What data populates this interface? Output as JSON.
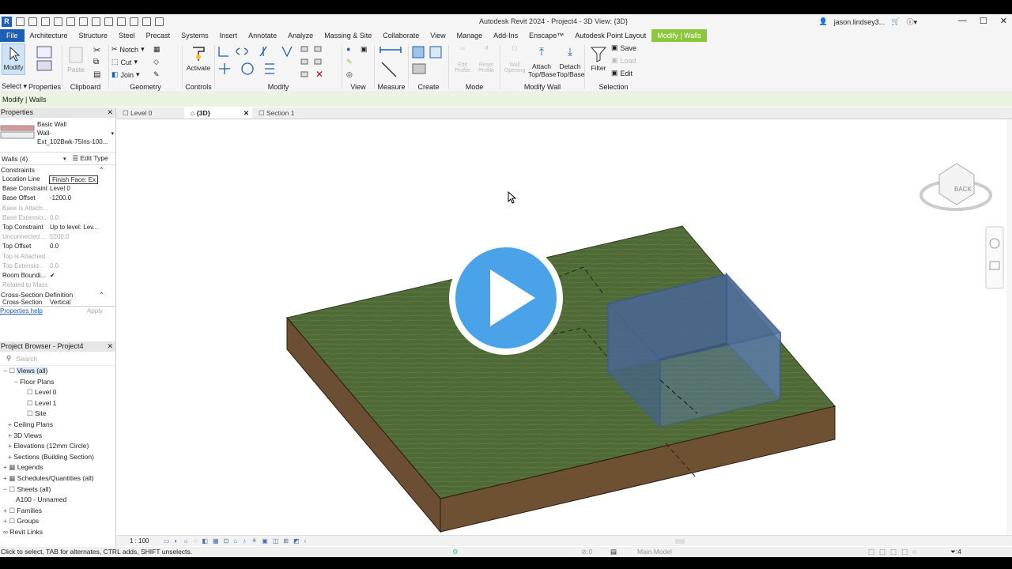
{
  "window": {
    "title": "Autodesk Revit 2024 - Project4 - 3D View: {3D}",
    "user": "jason.lindsey3..."
  },
  "menu_tabs": [
    "File",
    "Architecture",
    "Structure",
    "Steel",
    "Precast",
    "Systems",
    "Insert",
    "Annotate",
    "Analyze",
    "Massing & Site",
    "Collaborate",
    "View",
    "Manage",
    "Add-Ins",
    "Enscape™",
    "Autodesk Point Layout",
    "Modify | Walls"
  ],
  "ribbon": {
    "modify_label": "Modify",
    "select_label": "Select ▾",
    "properties_label": "Properties",
    "paste_label": "Paste",
    "clipboard_label": "Clipboard",
    "notch_label": "Notch",
    "cut_label": "Cut",
    "join_label": "Join",
    "geometry_label": "Geometry",
    "activate_label": "Activate",
    "controls_label": "Controls",
    "modify_panel_label": "Modify",
    "view_label": "View",
    "measure_label": "Measure",
    "create_label": "Create",
    "edit_profile": "Edit Profile",
    "reset_profile": "Reset Profile",
    "wall_opening": "Wall Opening",
    "mode_label": "Mode",
    "attach_top": "Attach Top/Base",
    "detach_top": "Detach Top/Base",
    "modify_wall_label": "Modify Wall",
    "filter_label": "Filter",
    "save_label": "Save",
    "load_label": "Load",
    "edit_label": "Edit",
    "selection_label": "Selection"
  },
  "context_bar": "Modify | Walls",
  "properties": {
    "title": "Properties",
    "type_line1": "Basic Wall",
    "type_line2": "Wall-",
    "type_line3": "Ext_102Bwk-75Ins-100...",
    "selector": "Walls (4)",
    "edit_type": "Edit Type",
    "section_constraints": "Constraints",
    "rows": [
      {
        "k": "Location Line",
        "v": "Finish Face: Ex"
      },
      {
        "k": "Base Constraint",
        "v": "Level 0"
      },
      {
        "k": "Base Offset",
        "v": "-1200.0"
      },
      {
        "k": "Base is Attach...",
        "v": ""
      },
      {
        "k": "Base Extensio...",
        "v": "0.0"
      },
      {
        "k": "Top Constraint",
        "v": "Up to level: Lev..."
      },
      {
        "k": "Unconnected ...",
        "v": "5200.0"
      },
      {
        "k": "Top Offset",
        "v": "0.0"
      },
      {
        "k": "Top is Attached",
        "v": ""
      },
      {
        "k": "Top Extensio...",
        "v": "0.0"
      },
      {
        "k": "Room Boundi...",
        "v": "✔"
      },
      {
        "k": "Related to Mass",
        "v": ""
      }
    ],
    "section_cross": "Cross-Section Definition",
    "cross_row_k": "Cross-Section",
    "cross_row_v": "Vertical",
    "help": "Properties help",
    "apply": "Apply"
  },
  "browser": {
    "title": "Project Browser - Project4",
    "search_placeholder": "Search",
    "items": [
      "Views (all)",
      "Floor Plans",
      "Level 0",
      "Level 1",
      "Site",
      "Ceiling Plans",
      "3D Views",
      "Elevations (12mm Circle)",
      "Sections (Building Section)",
      "Legends",
      "Schedules/Quantities (all)",
      "Sheets (all)",
      "A100 - Unnamed",
      "Families",
      "Groups",
      "Revit Links"
    ]
  },
  "view_tabs": [
    "Level 0",
    "{3D}",
    "Section 1"
  ],
  "viewcube_label": "BACK",
  "scale": "1 : 100",
  "model_label": "Main Model",
  "status_text": "Click to select, TAB for alternates, CTRL adds, SHIFT unselects.",
  "filter_count": "4",
  "colors": {
    "accent": "#1d5fb5",
    "context": "#8cc63f",
    "play": "#4aa3e8",
    "ground": "#4f6a37",
    "soil": "#6b4e34",
    "wall": "#5b7aa8"
  }
}
